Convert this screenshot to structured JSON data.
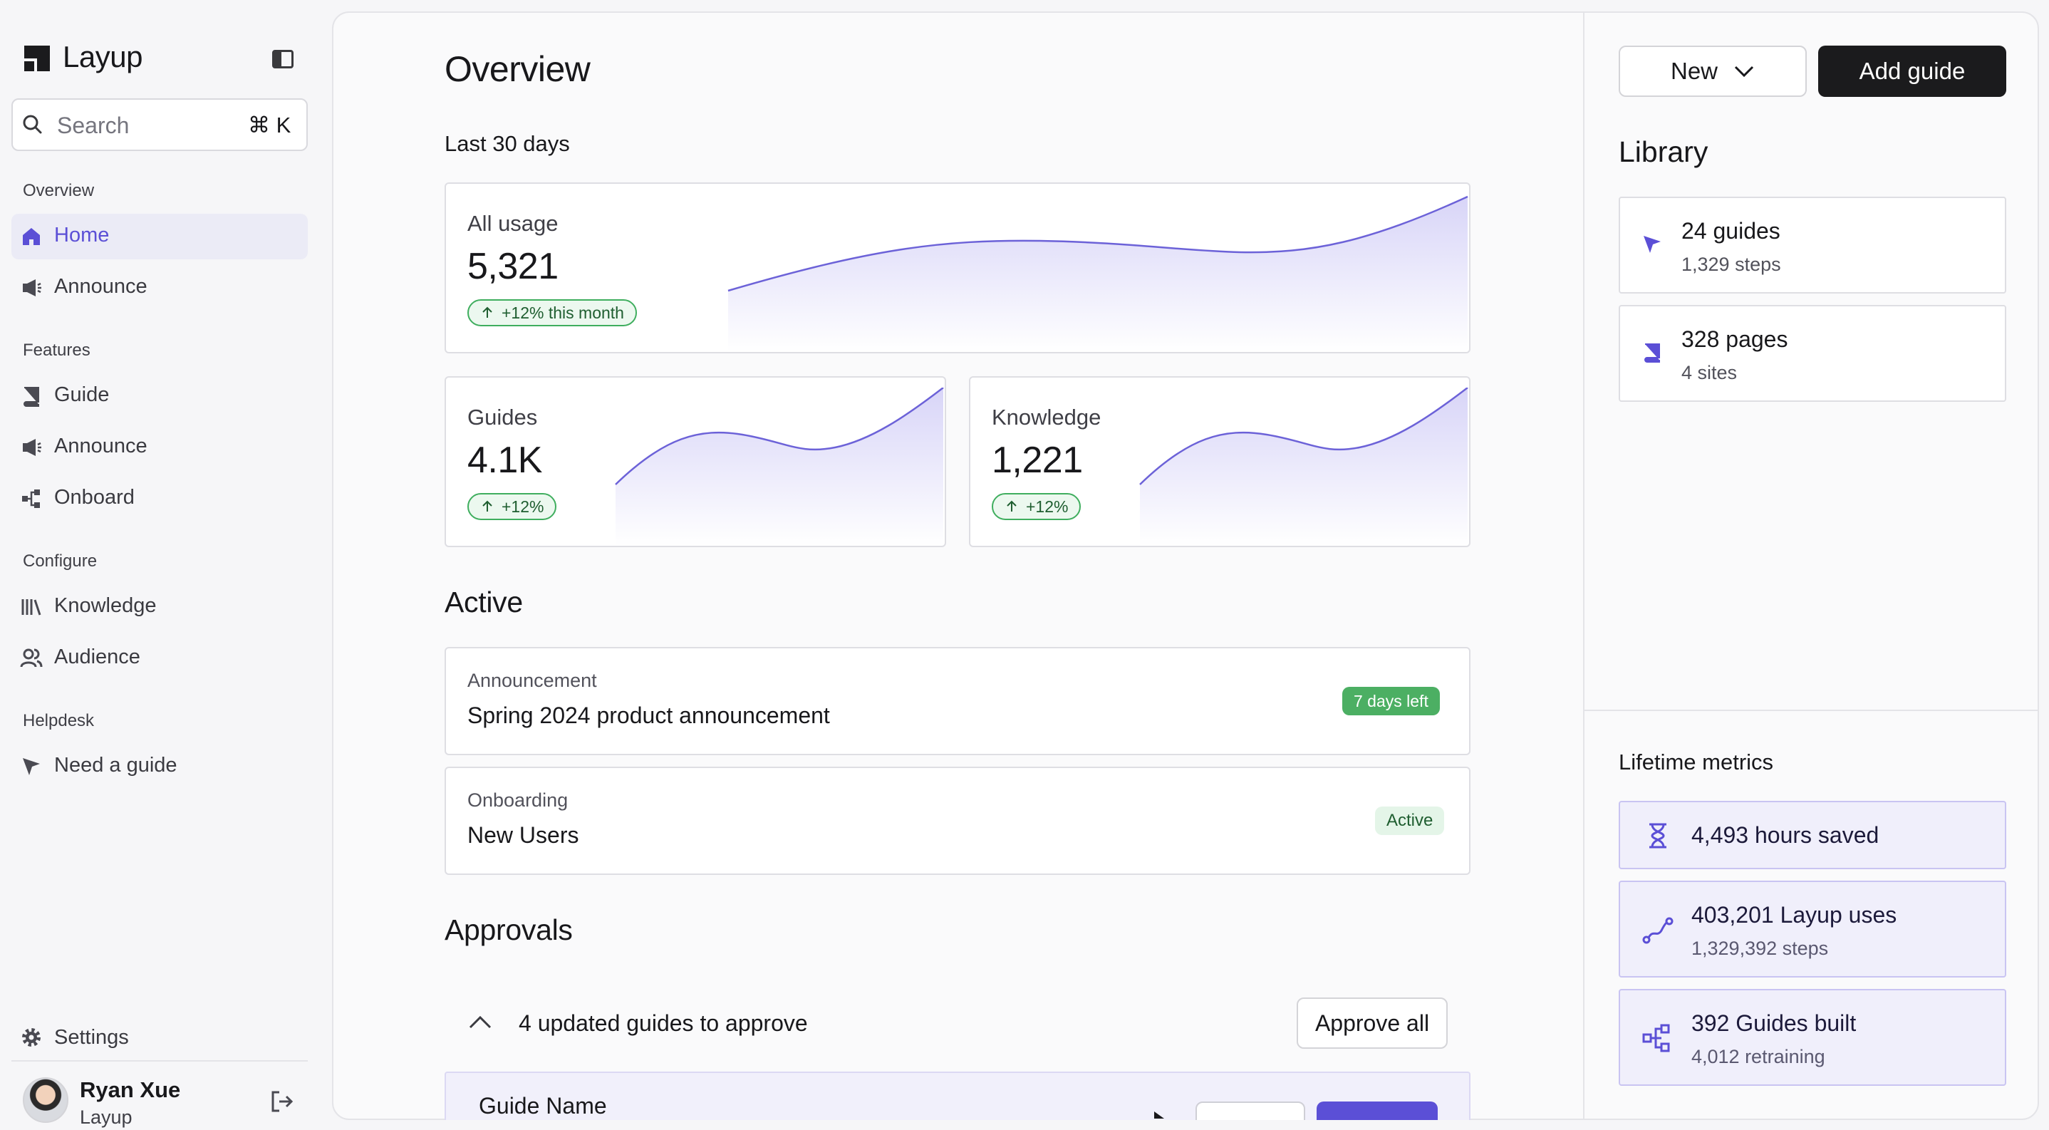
{
  "app": {
    "name": "Layup"
  },
  "search": {
    "placeholder": "Search",
    "shortcut": "⌘ K"
  },
  "sidebar": {
    "sections": {
      "overview": "Overview",
      "features": "Features",
      "configure": "Configure",
      "helpdesk": "Helpdesk"
    },
    "items": {
      "home": "Home",
      "announce_top": "Announce",
      "guide": "Guide",
      "announce": "Announce",
      "onboard": "Onboard",
      "knowledge": "Knowledge",
      "audience": "Audience",
      "need_guide": "Need a guide",
      "settings": "Settings"
    },
    "active_item": "home"
  },
  "user": {
    "name": "Ryan Xue",
    "org": "Layup"
  },
  "main": {
    "title": "Overview",
    "period": "Last 30 days",
    "stats": {
      "all_usage": {
        "label": "All usage",
        "value": "5,321",
        "change": "+12% this month"
      },
      "guides": {
        "label": "Guides",
        "value": "4.1K",
        "change": "+12%"
      },
      "knowledge": {
        "label": "Knowledge",
        "value": "1,221",
        "change": "+12%"
      }
    },
    "active": {
      "title": "Active",
      "rows": [
        {
          "kicker": "Announcement",
          "title": "Spring 2024 product announcement",
          "status": "7 days left"
        },
        {
          "kicker": "Onboarding",
          "title": "New Users",
          "status": "Active"
        }
      ]
    },
    "approvals": {
      "title": "Approvals",
      "summary": "4 updated guides to approve",
      "approve_all": "Approve all",
      "row": {
        "name": "Guide Name"
      }
    }
  },
  "right": {
    "new_label": "New",
    "add_guide_label": "Add guide",
    "library": {
      "title": "Library",
      "items": [
        {
          "main": "24 guides",
          "sub": "1,329 steps",
          "icon": "cursor-icon"
        },
        {
          "main": "328 pages",
          "sub": "4 sites",
          "icon": "book-icon"
        }
      ]
    },
    "lifetime": {
      "title": "Lifetime metrics",
      "items": [
        {
          "main": "4,493 hours saved",
          "icon": "hourglass-icon"
        },
        {
          "main": "403,201 Layup uses",
          "sub": "1,329,392 steps",
          "icon": "route-icon"
        },
        {
          "main": "392 Guides built",
          "sub": "4,012 retraining",
          "icon": "flow-icon"
        }
      ]
    }
  },
  "colors": {
    "accent": "#5b4fd6",
    "success": "#4caf63",
    "dark_button": "#1b1b1d"
  }
}
